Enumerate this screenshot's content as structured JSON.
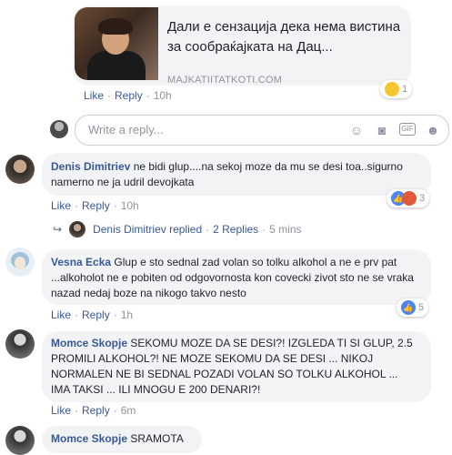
{
  "link_card": {
    "title": "Дали е сензација дека нема вистина за сообраќајката на Дац...",
    "domain": "MAJKATIITATKOTI.COM",
    "actions": {
      "like": "Like",
      "reply": "Reply",
      "time": "10h"
    },
    "reaction_count": "1"
  },
  "reply_box": {
    "placeholder": "Write a reply..."
  },
  "comments": [
    {
      "author": "Denis Dimitriev",
      "text": "ne bidi glup....na sekoj moze da mu se desi toa..sigurno namerno ne ja udril devojkata",
      "like": "Like",
      "reply": "Reply",
      "time": "10h",
      "reaction_count": "3",
      "replies_summary": {
        "author": "Denis Dimitriev",
        "replied": "replied",
        "count": "2 Replies",
        "time": "5 mins"
      }
    },
    {
      "author": "Vesna Ecka",
      "text": "Glup e sto sednal zad volan so tolku alkohol a ne e prv pat ...alkoholot ne e pobiten od odgovornosta kon covecki zivot sto ne se vraka nazad nedaj boze na nikogo takvo nesto",
      "like": "Like",
      "reply": "Reply",
      "time": "1h",
      "reaction_count": "5"
    },
    {
      "author": "Momce Skopje",
      "text": "SEKOMU MOZE DA SE DESI?! IZGLEDA TI SI GLUP, 2.5 PROMILI ALKOHOL?! NE MOZE SEKOMU DA SE DESI ... NIKOJ NORMALEN NE BI SEDNAL POZADI VOLAN SO TOLKU ALKOHOL ... IMA TAKSI ... ILI MNOGU E 200 DENARI?!",
      "like": "Like",
      "reply": "Reply",
      "time": "6m"
    },
    {
      "author": "Momce Skopje",
      "text": "SRAMOTA"
    }
  ],
  "colors": {
    "link": "#385898",
    "bubble": "#f2f3f5",
    "meta": "#90949c"
  }
}
